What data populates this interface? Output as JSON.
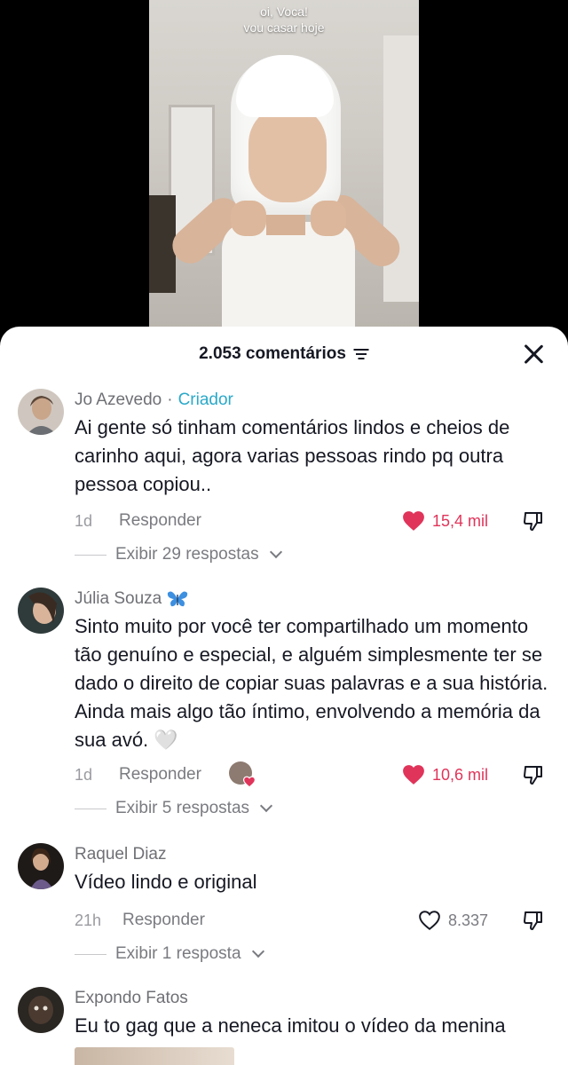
{
  "video": {
    "caption_line1": "oi, Voca!",
    "caption_line2": "vou casar hoje"
  },
  "comments_sheet": {
    "title": "2.053 comentários",
    "close_icon": "close-icon",
    "filter_icon": "filter-icon"
  },
  "comments": [
    {
      "author": "Jo Azevedo",
      "separator": "·",
      "badge": "Criador",
      "text": "Ai gente só tinham comentários lindos e cheios de carinho aqui, agora varias pessoas rindo pq outra pessoa copiou..",
      "time": "1d",
      "reply_label": "Responder",
      "likes": "15,4 mil",
      "liked": true,
      "replies_label": "Exibir 29 respostas"
    },
    {
      "author": "Júlia Souza",
      "author_emoji": "blue-butterfly-icon",
      "text": "Sinto muito por você ter compartilhado um momento tão genuíno e especial, e alguém simplesmente ter se dado o direito de copiar suas palavras e a sua história. Ainda mais algo tão íntimo, envolvendo a memória da sua avó. 🤍",
      "time": "1d",
      "reply_label": "Responder",
      "likes": "10,6 mil",
      "liked": true,
      "liked_by_creator": true,
      "replies_label": "Exibir 5 respostas"
    },
    {
      "author": "Raquel Diaz",
      "text": "Vídeo lindo e original",
      "time": "21h",
      "reply_label": "Responder",
      "likes": "8.337",
      "liked": false,
      "replies_label": "Exibir 1 resposta"
    },
    {
      "author": "Expondo Fatos",
      "text": "Eu to gag que a neneca imitou o vídeo da menina"
    }
  ],
  "colors": {
    "accent_like": "#e0345a",
    "creator_badge": "#2aa9c9",
    "text_primary": "#161823",
    "text_secondary": "#7a7b80"
  }
}
